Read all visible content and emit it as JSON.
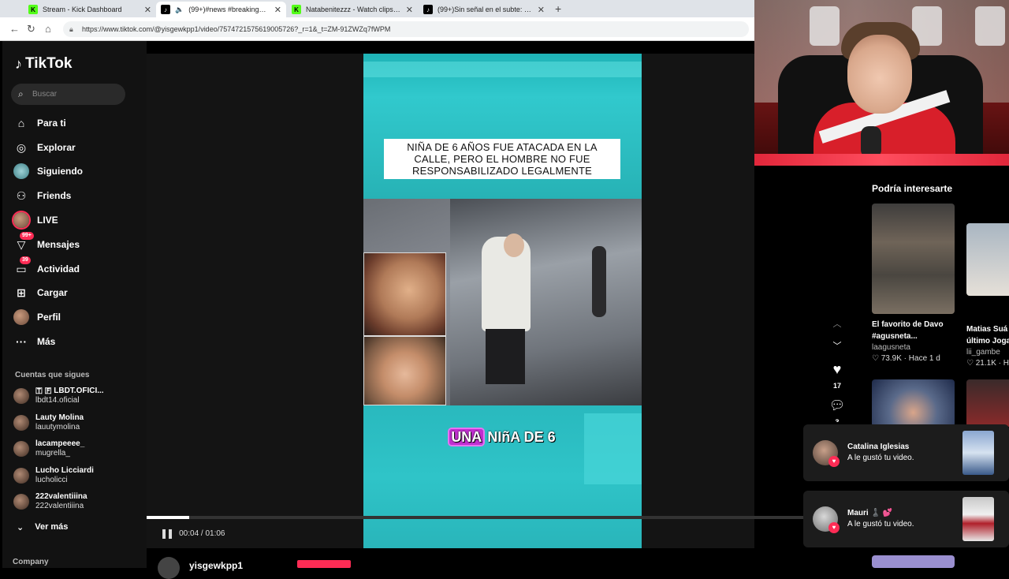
{
  "browser": {
    "tabs": [
      {
        "title": "Stream - Kick Dashboard",
        "favicon": "kick-icon",
        "active": false
      },
      {
        "title": "(99+)#news #breakingnews",
        "favicon": "tiktok-icon",
        "active": true
      },
      {
        "title": "Natabenitezzz - Watch clips on Ki",
        "favicon": "kick-icon",
        "active": false
      },
      {
        "title": "(99+)Sin señal en el subte: Una b",
        "favicon": "tiktok-icon",
        "active": false
      }
    ],
    "url": "https://www.tiktok.com/@yisgewkpp1/video/7574721575619005726?_r=1&_t=ZM-91ZWZq7fWPM"
  },
  "sidebar": {
    "logo": "TikTok",
    "search_placeholder": "Buscar",
    "nav": [
      {
        "label": "Para ti",
        "icon": "home-icon"
      },
      {
        "label": "Explorar",
        "icon": "compass-icon"
      },
      {
        "label": "Siguiendo",
        "icon": "following-avatar-icon"
      },
      {
        "label": "Friends",
        "icon": "friends-icon"
      },
      {
        "label": "LIVE",
        "icon": "live-avatar-icon"
      },
      {
        "label": "Mensajes",
        "icon": "messages-icon",
        "badge": "99+"
      },
      {
        "label": "Actividad",
        "icon": "activity-icon",
        "badge": "39"
      },
      {
        "label": "Cargar",
        "icon": "upload-icon"
      },
      {
        "label": "Perfil",
        "icon": "profile-avatar-icon"
      },
      {
        "label": "Más",
        "icon": "more-icon"
      }
    ],
    "following_title": "Cuentas que sigues",
    "following": [
      {
        "name": "🇹 🇫 LBDT.OFICI...",
        "handle": "lbdt14.oficial"
      },
      {
        "name": "Lauty Molina",
        "handle": "lauutymolina"
      },
      {
        "name": "lacampeeee_",
        "handle": "mugrella_"
      },
      {
        "name": "Lucho Licciardi",
        "handle": "lucholicci"
      },
      {
        "name": "222valentiiina",
        "handle": "222valentiiina"
      }
    ],
    "see_more": "Ver más",
    "company": "Company"
  },
  "video": {
    "headline": "NIÑA DE 6 AÑOS FUE ATACADA EN LA CALLE, PERO EL HOMBRE NO FUE RESPONSABILIZADO LEGALMENTE",
    "caption_highlight": "UNA",
    "caption_rest": " NIñA DE 6",
    "time": "00:04 / 01:06",
    "progress": 0.06,
    "author": "yisgewkpp1",
    "likes": "17",
    "comments": "3"
  },
  "recommend": {
    "title": "Podría interesarte",
    "cards": [
      {
        "title": "El favorito de Davo #agusneta...",
        "handle": "laagusneta",
        "likes": "73.9K",
        "age": "Hace 1 d"
      },
      {
        "title": "Matias Suá último Joga",
        "handle": "lii_gambe",
        "likes": "21.1K",
        "age": "H"
      }
    ]
  },
  "notifications": [
    {
      "name": "Catalina Iglesias",
      "message": "A le gustó tu video."
    },
    {
      "name": "Mauri ♟️ 💕",
      "message": "A le gustó tu video."
    }
  ],
  "colors": {
    "accent": "#fe2c55",
    "kick": "#53fc18",
    "video_teal": "#2ab8bd",
    "caption_highlight": "#c02fd0"
  }
}
